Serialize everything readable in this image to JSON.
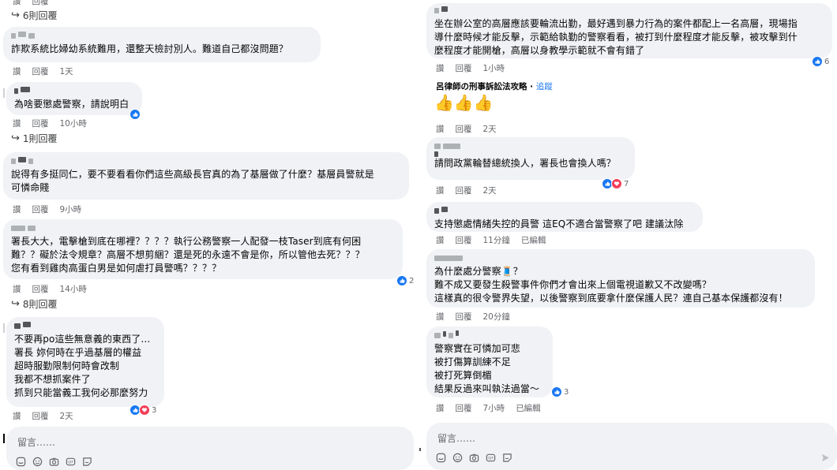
{
  "labels": {
    "like": "讚",
    "reply": "回覆",
    "edited": "已編輯"
  },
  "left": {
    "top_reply_count": "6則回覆",
    "comments": [
      {
        "text": "詐欺系統比婦幼系統難用，還整天檢討別人。難道自己都沒問題？",
        "time": "1天"
      },
      {
        "text": "為啥要懲處警察，請說明白",
        "time": "10小時",
        "reply_count": "1則回覆"
      },
      {
        "text": "說得有多挺同仁，要不要看看你們這些高級長官真的為了基層做了什麼？基層員警就是\n可憐命賤",
        "time": "9小時"
      },
      {
        "text": "署長大大，電擊槍到底在哪裡？？？？執行公務警察一人配發一枝Taser到底有何困\n難？？礙於法令規章？高層不想剪綑？還是死的永遠不會是你，所以管他去死？？？\n您有看到雞肉高蛋白男是如何虐打員警嗎？？？？",
        "time": "14小時",
        "reactions": "2",
        "reply_count": "8則回覆"
      },
      {
        "text": "不要再po這些無意義的東西了…\n署長 妳何時在乎過基層的權益\n超時服勤限制何時會改制\n我都不想抓案件了\n抓到只能當義工我何必那麼努力",
        "time": "2天",
        "reactions": "3"
      }
    ],
    "input_placeholder": "留言……"
  },
  "right": {
    "comments": [
      {
        "text": "坐在辦公室的高層應該要輪流出勤，最好遇到暴力行為的案件都配上一名高層，現場指\n導什麼時候才能反擊，示範給執勤的警察看看，被打到什麼程度才能反擊，被攻擊到什\n麼程度才能開槍，高層以身教學示範就不會有錯了",
        "time": "1小時",
        "reactions": "6"
      },
      {
        "page_name": "呂律師の刑事訴訟法攻略",
        "follow": "追蹤",
        "separator": " · ",
        "text": "👍👍👍",
        "time": "2天"
      },
      {
        "text": "請問政黨輪替總統換人，署長也會換人嗎？",
        "time": "2天",
        "reactions": "7"
      },
      {
        "text": "支持懲處情緒失控的員警 這EQ不適合當警察了吧 建議汰除",
        "time": "11分鐘",
        "edited": true
      },
      {
        "text": "為什麼處分警察🧵？\n難不成又要發生殺警事件你們才會出來上個電視道歉又不改變嗎？\n這樣真的很令警界失望，以後警察到底要拿什麼保護人民？連自己基本保護都沒有！",
        "time": "20分鐘"
      },
      {
        "text": "警察實在可憐加可悲\n被打傷算訓練不足\n被打死算倒楣\n結果反過來叫執法過當～",
        "time": "7小時",
        "reactions": "3",
        "edited": true
      }
    ],
    "input_placeholder": "留言……"
  },
  "icons": [
    "reply-arrow-icon",
    "like-icon",
    "heart-icon",
    "sticker-icon",
    "emoji-icon",
    "camera-icon",
    "gif-icon",
    "avatar-sticker-icon",
    "send-icon"
  ],
  "colors": {
    "bubble": "#f0f2f5",
    "like": "#1877f2",
    "heart": "#f33e58",
    "muted": "#65676b"
  }
}
